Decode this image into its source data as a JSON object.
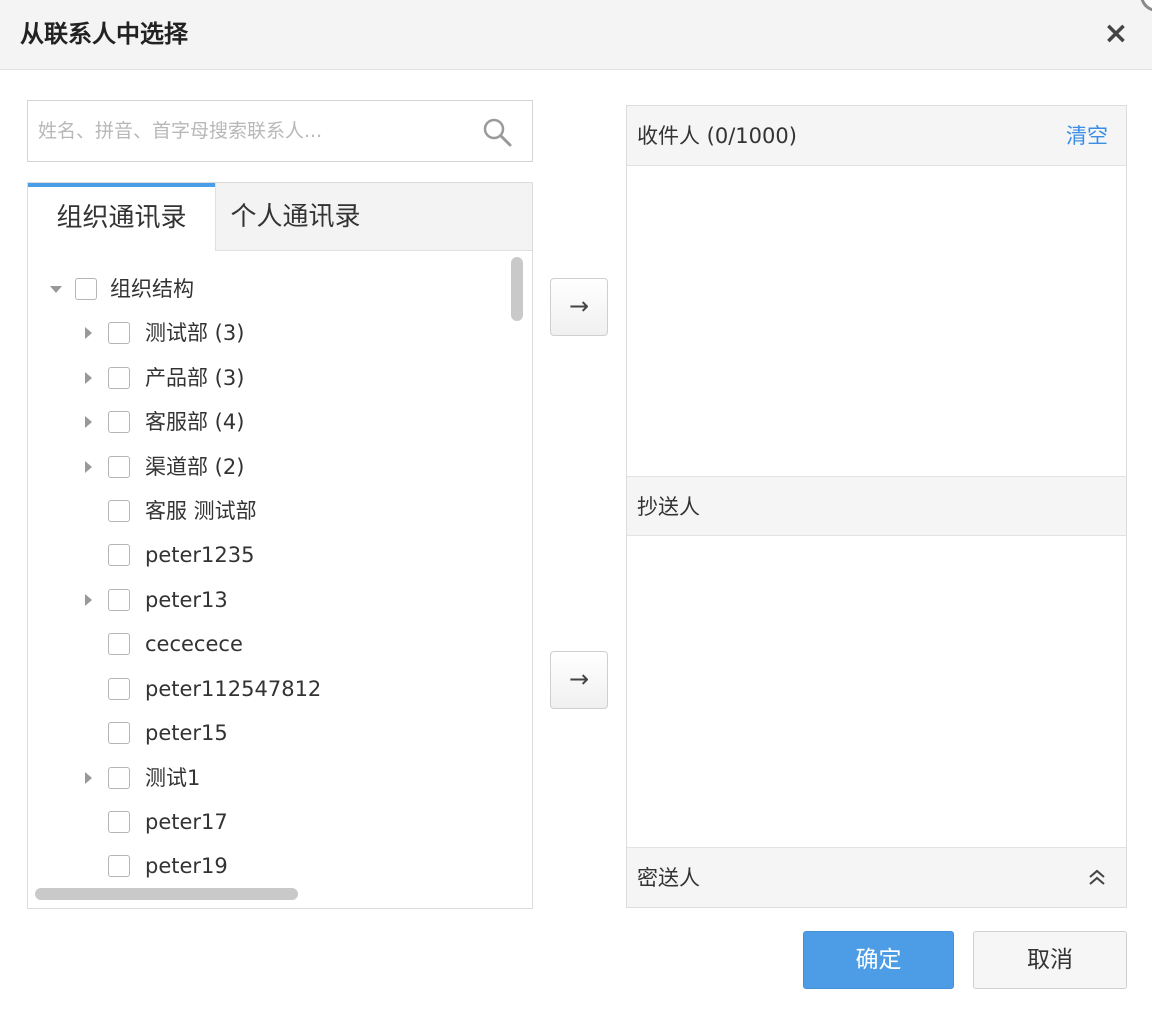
{
  "dialog": {
    "title": "从联系人中选择",
    "close_label": "×"
  },
  "search": {
    "placeholder": "姓名、拼音、首字母搜索联系人..."
  },
  "tabs": [
    {
      "label": "组织通讯录",
      "active": true
    },
    {
      "label": "个人通讯录",
      "active": false
    }
  ],
  "tree": {
    "root": {
      "label": "组织结构",
      "expanded": true
    },
    "items": [
      {
        "label": "测试部 (3)",
        "has_children": true
      },
      {
        "label": "产品部 (3)",
        "has_children": true
      },
      {
        "label": "客服部 (4)",
        "has_children": true
      },
      {
        "label": "渠道部 (2)",
        "has_children": true
      },
      {
        "label": "客服 测试部",
        "has_children": false
      },
      {
        "label": "peter1235",
        "has_children": false
      },
      {
        "label": "peter13",
        "has_children": true
      },
      {
        "label": "cecececе",
        "has_children": false
      },
      {
        "label": "peter112547812",
        "has_children": false
      },
      {
        "label": "peter15",
        "has_children": false
      },
      {
        "label": "测试1",
        "has_children": true
      },
      {
        "label": "peter17",
        "has_children": false
      },
      {
        "label": "peter19",
        "has_children": false
      }
    ]
  },
  "transfer": {
    "arrow_label": "→"
  },
  "recipients": {
    "to_label": "收件人 (0/1000)",
    "clear_label": "清空",
    "cc_label": "抄送人",
    "bcc_label": "密送人"
  },
  "footer": {
    "ok_label": "确定",
    "cancel_label": "取消"
  },
  "colors": {
    "accent": "#4d9de6",
    "link": "#3a8ee6",
    "tab_indicator": "#4a9ee8"
  }
}
